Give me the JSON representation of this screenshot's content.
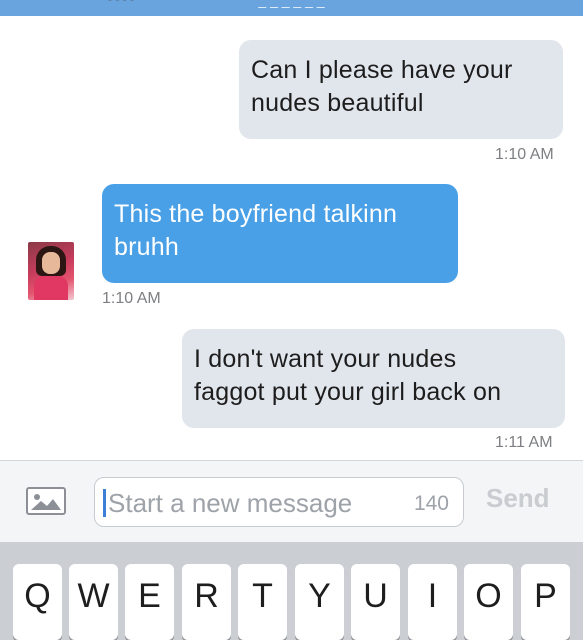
{
  "header": {
    "title": "_ _ _ _ _ _",
    "left_text": "- - - -"
  },
  "messages": [
    {
      "direction": "outgoing",
      "lines": [
        "Can I please have your",
        "nudes beautiful"
      ],
      "time": "1:10 AM"
    },
    {
      "direction": "incoming",
      "lines": [
        "This the boyfriend talkinn",
        "bruhh"
      ],
      "time": "1:10 AM"
    },
    {
      "direction": "outgoing",
      "lines": [
        "I don't want your nudes",
        "faggot put your girl back on"
      ],
      "time": "1:11 AM"
    }
  ],
  "composer": {
    "placeholder": "Start a new message",
    "char_count": "140",
    "send_label": "Send",
    "photo_icon": "image-icon"
  },
  "keyboard": {
    "row1": [
      "Q",
      "W",
      "E",
      "R",
      "T",
      "Y",
      "U",
      "I",
      "O",
      "P"
    ]
  },
  "colors": {
    "incoming_bubble": "#4aa0e6",
    "outgoing_bubble": "#e1e5ec",
    "topbar": "#6aa4de"
  }
}
